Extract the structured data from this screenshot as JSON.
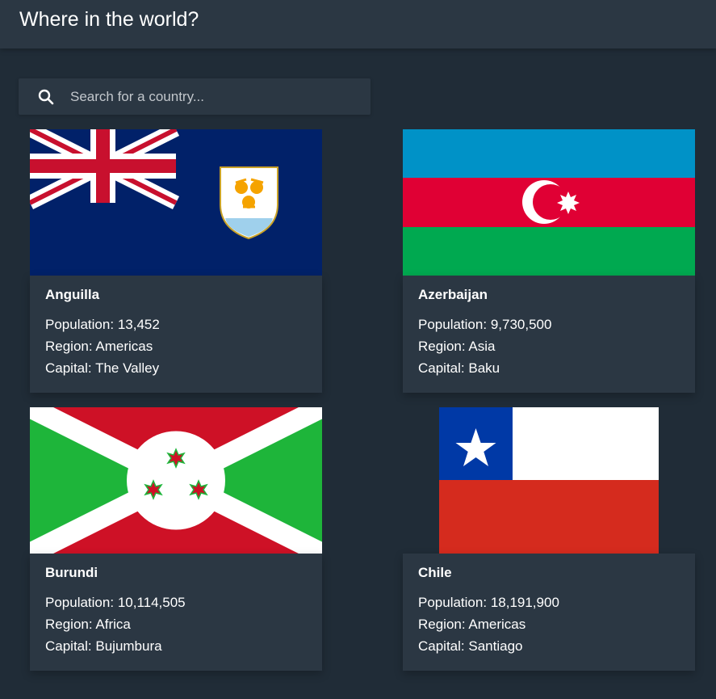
{
  "header": {
    "title": "Where in the world?"
  },
  "search": {
    "placeholder": "Search for a country..."
  },
  "countries": [
    {
      "name": "Anguilla",
      "population": "13,452",
      "region": "Americas",
      "capital": "The Valley"
    },
    {
      "name": "Azerbaijan",
      "population": "9,730,500",
      "region": "Asia",
      "capital": "Baku"
    },
    {
      "name": "Burundi",
      "population": "10,114,505",
      "region": "Africa",
      "capital": "Bujumbura"
    },
    {
      "name": "Chile",
      "population": "18,191,900",
      "region": "Americas",
      "capital": "Santiago"
    }
  ],
  "labels": {
    "population": "Population:",
    "region": "Region:",
    "capital": "Capital:"
  },
  "colors": {
    "background": "#202c37",
    "surface": "#2b3743",
    "text": "#ffffff"
  }
}
